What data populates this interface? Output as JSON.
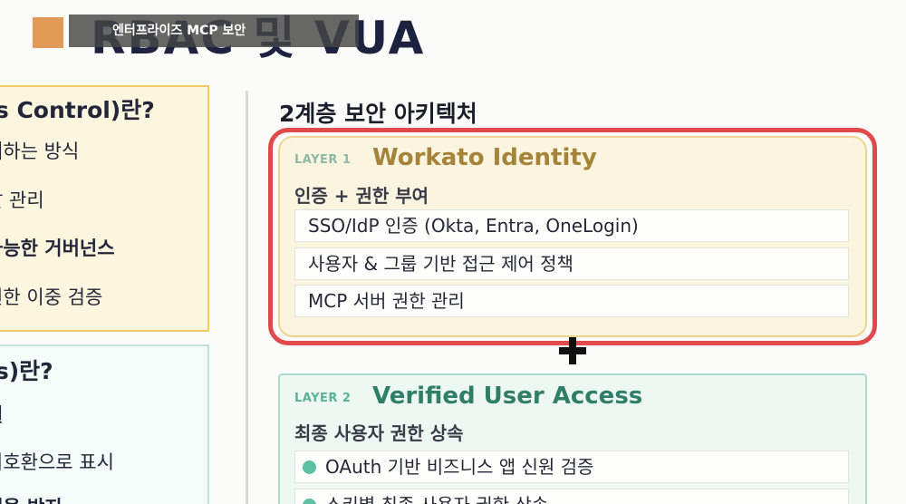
{
  "header": {
    "overlay_text": "엔터프라이즈 MCP 보안",
    "big_title": "RBAC 및 VUA"
  },
  "left_panel": {
    "box1": {
      "title": "ss Control)란?",
      "line1_bold": "어",
      "line1_rest": "하는 방식",
      "line2": "발 관리",
      "line3": "가능한 거버넌스",
      "line4": "권한 이중 검증"
    },
    "box2": {
      "title": "ss)란?",
      "line1": "결",
      "line2": "비호환으로 표시",
      "line3": "해을 방지"
    }
  },
  "main": {
    "heading": "2계층 보안 아키텍처",
    "layer1": {
      "num": "LAYER 1",
      "title": "Workato Identity",
      "subtitle": "인증 + 권한 부여",
      "items": [
        "SSO/IdP 인증 (Okta, Entra, OneLogin)",
        "사용자 & 그룹 기반 접근 제어 정책",
        "MCP 서버 권한 관리"
      ]
    },
    "layer2": {
      "num": "LAYER 2",
      "title": "Verified User Access",
      "subtitle": "최종 사용자 권한 상속",
      "items": [
        "OAuth 기반 비즈니스 앱 신원 검증",
        "스키별 최종 사용자 권한 상속"
      ]
    }
  },
  "colors": {
    "accent_orange": "#e39a56",
    "layer1_gold": "#a5843a",
    "layer2_green": "#2f7f66",
    "highlight_red": "#e04a4a"
  },
  "icons": {
    "plus": "plus-icon",
    "bullet": "bullet-dot-icon"
  }
}
